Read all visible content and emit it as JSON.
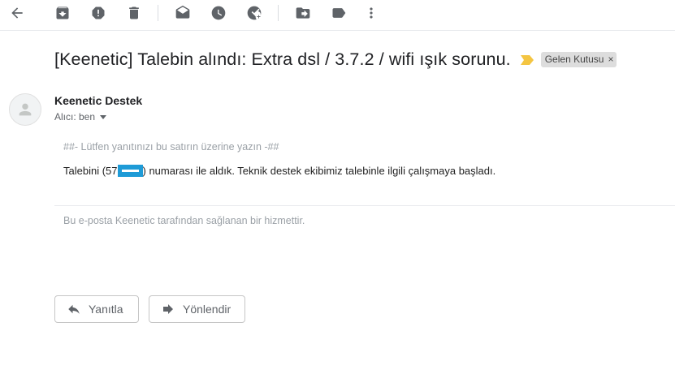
{
  "toolbar": {
    "icons": [
      "back-arrow-icon",
      "archive-icon",
      "report-spam-icon",
      "delete-icon",
      "mark-unread-icon",
      "snooze-icon",
      "add-task-icon",
      "move-to-icon",
      "labels-icon",
      "more-vert-icon"
    ]
  },
  "email": {
    "subject": "[Keenetic] Talebin alındı: Extra dsl / 3.7.2 / wifi ışık sorunu.",
    "label": "Gelen Kutusu",
    "label_remove": "×",
    "sender": "Keenetic Destek",
    "recipient": "Alıcı: ben",
    "reply_hint": "##- Lütfen yanıtınızı bu satırın üzerine yazın -##",
    "body_before": "Talebini (57",
    "body_after": ") numarası ile aldık. Teknik destek ekibimiz talebinle ilgili çalışmaya başladı.",
    "footer": "Bu e-posta Keenetic tarafından sağlanan bir hizmettir."
  },
  "actions": {
    "reply_label": "Yanıtla",
    "forward_label": "Yönlendir"
  },
  "colors": {
    "importance_marker": "#f4c542",
    "redaction": "#1e9bd7",
    "label_chip_bg": "#dddddd"
  }
}
